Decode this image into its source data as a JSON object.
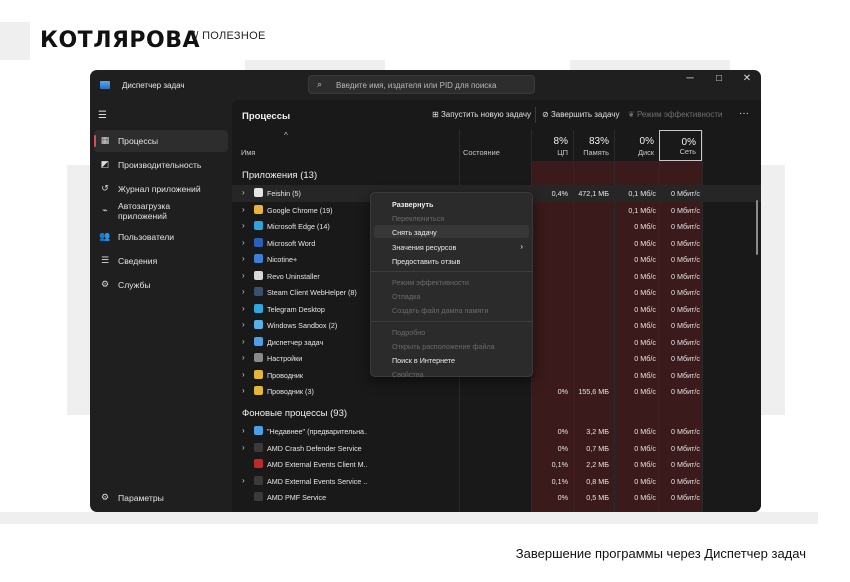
{
  "site": {
    "logo": "КОТЛЯРОВА",
    "section": "// ПОЛЕЗНОЕ",
    "caption": "Завершение программы через Диспетчер задач"
  },
  "window": {
    "title": "Диспетчер задач",
    "search_placeholder": "Введите имя, издателя или PID для поиска",
    "controls": {
      "minimize": "─",
      "maximize": "□",
      "close": "✕"
    }
  },
  "sidebar": {
    "items": [
      {
        "label": "Процессы",
        "icon": "processes-icon",
        "glyph": "▦",
        "active": true
      },
      {
        "label": "Производительность",
        "icon": "performance-icon",
        "glyph": "◩"
      },
      {
        "label": "Журнал приложений",
        "icon": "history-icon",
        "glyph": "↺"
      },
      {
        "label": "Автозагрузка приложений",
        "icon": "startup-icon",
        "glyph": "⌁"
      },
      {
        "label": "Пользователи",
        "icon": "users-icon",
        "glyph": "👥"
      },
      {
        "label": "Сведения",
        "icon": "details-icon",
        "glyph": "☰"
      },
      {
        "label": "Службы",
        "icon": "services-icon",
        "glyph": "⚙"
      }
    ],
    "settings": {
      "label": "Параметры",
      "icon": "settings-icon",
      "glyph": "⚙"
    }
  },
  "toolbar": {
    "title": "Процессы",
    "run_new_task": "Запустить новую задачу",
    "end_task": "Завершить задачу",
    "efficiency_mode": "Режим эффективности",
    "more": "···"
  },
  "columns": {
    "name": "Имя",
    "status": "Состояние",
    "cpu_pct": "8%",
    "cpu": "ЦП",
    "mem_pct": "83%",
    "mem": "Память",
    "disk_pct": "0%",
    "disk": "Диск",
    "net_pct": "0%",
    "net": "Сеть"
  },
  "apps_group": "Приложения (13)",
  "apps": [
    {
      "name": "Feishin (5)",
      "cpu": "0,4%",
      "mem": "472,1 МБ",
      "disk": "0,1 Мб/с",
      "net": "0 Мбит/с",
      "color": "#e5e5e5"
    },
    {
      "name": "Google Chrome (19)",
      "cpu": "",
      "mem": "",
      "disk": "0,1 Мб/с",
      "net": "0 Мбит/с",
      "color": "#e8b43a"
    },
    {
      "name": "Microsoft Edge (14)",
      "cpu": "",
      "mem": "",
      "disk": "0 Мб/с",
      "net": "0 Мбит/с",
      "color": "#2fa4d9"
    },
    {
      "name": "Microsoft Word",
      "cpu": "",
      "mem": "",
      "disk": "0 Мб/с",
      "net": "0 Мбит/с",
      "color": "#2b5fb8"
    },
    {
      "name": "Nicotine+",
      "cpu": "",
      "mem": "",
      "disk": "0 Мб/с",
      "net": "0 Мбит/с",
      "color": "#3d7fd6"
    },
    {
      "name": "Revo Uninstaller",
      "cpu": "",
      "mem": "",
      "disk": "0 Мб/с",
      "net": "0 Мбит/с",
      "color": "#d9d9d9"
    },
    {
      "name": "Steam Client WebHelper (8)",
      "cpu": "",
      "mem": "",
      "disk": "0 Мб/с",
      "net": "0 Мбит/с",
      "color": "#3b4f6e"
    },
    {
      "name": "Telegram Desktop",
      "cpu": "",
      "mem": "",
      "disk": "0 Мб/с",
      "net": "0 Мбит/с",
      "color": "#2ea6e0"
    },
    {
      "name": "Windows Sandbox (2)",
      "cpu": "",
      "mem": "",
      "disk": "0 Мб/с",
      "net": "0 Мбит/с",
      "color": "#5ab0e8"
    },
    {
      "name": "Диспетчер задач",
      "cpu": "",
      "mem": "",
      "disk": "0 Мб/с",
      "net": "0 Мбит/с",
      "color": "#4f9fe8"
    },
    {
      "name": "Настройки",
      "cpu": "",
      "mem": "",
      "disk": "0 Мб/с",
      "net": "0 Мбит/с",
      "color": "#8a8a8a"
    },
    {
      "name": "Проводник",
      "cpu": "",
      "mem": "",
      "disk": "0 Мб/с",
      "net": "0 Мбит/с",
      "color": "#e3b53a"
    },
    {
      "name": "Проводник (3)",
      "cpu": "0%",
      "mem": "155,6 МБ",
      "disk": "0 Мб/с",
      "net": "0 Мбит/с",
      "color": "#e3b53a"
    }
  ],
  "bg_group": "Фоновые процессы (93)",
  "bg": [
    {
      "name": "\"Недавнее\" (предварительна...",
      "cpu": "0%",
      "mem": "3,2 МБ",
      "disk": "0 Мб/с",
      "net": "0 Мбит/с",
      "color": "#4f9fe8",
      "chevron": true
    },
    {
      "name": "AMD Crash Defender Service",
      "cpu": "0%",
      "mem": "0,7 МБ",
      "disk": "0 Мб/с",
      "net": "0 Мбит/с",
      "color": "#3a3a3a",
      "chevron": true
    },
    {
      "name": "AMD External Events Client M...",
      "cpu": "0,1%",
      "mem": "2,2 МБ",
      "disk": "0 Мб/с",
      "net": "0 Мбит/с",
      "color": "#c0282d",
      "chevron": false
    },
    {
      "name": "AMD External Events Service ...",
      "cpu": "0,1%",
      "mem": "0,8 МБ",
      "disk": "0 Мб/с",
      "net": "0 Мбит/с",
      "color": "#3a3a3a",
      "chevron": true
    },
    {
      "name": "AMD PMF Service",
      "cpu": "0%",
      "mem": "0,5 МБ",
      "disk": "0 Мб/с",
      "net": "0 Мбит/с",
      "color": "#3a3a3a",
      "chevron": false
    }
  ],
  "context_menu": [
    {
      "label": "Развернуть",
      "state": "bold"
    },
    {
      "label": "Переключиться",
      "state": "disabled"
    },
    {
      "label": "Снять задачу",
      "state": "hover"
    },
    {
      "label": "Значения ресурсов",
      "state": "normal",
      "submenu": true
    },
    {
      "label": "Предоставить отзыв",
      "state": "normal"
    },
    {
      "sep": true
    },
    {
      "label": "Режим эффективности",
      "state": "disabled"
    },
    {
      "label": "Отладка",
      "state": "disabled"
    },
    {
      "label": "Создать файл дампа памяти",
      "state": "disabled"
    },
    {
      "sep": true
    },
    {
      "label": "Подробно",
      "state": "disabled"
    },
    {
      "label": "Открыть расположение файла",
      "state": "disabled"
    },
    {
      "label": "Поиск в Интернете",
      "state": "normal"
    },
    {
      "label": "Свойства",
      "state": "disabled"
    }
  ]
}
